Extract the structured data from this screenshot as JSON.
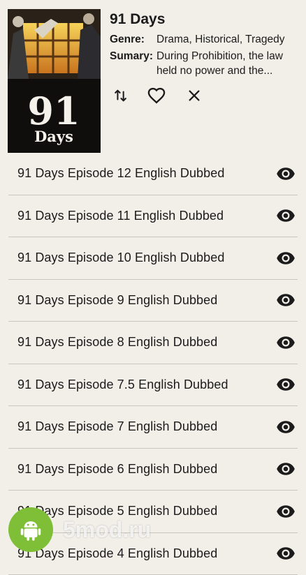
{
  "anime": {
    "title": "91 Days",
    "genre_label": "Genre:",
    "genre_value": "Drama, Historical, Tragedy",
    "summary_label": "Sumary:",
    "summary_value": "During Prohibition, the law held no power and the...",
    "poster_text_big": "91",
    "poster_text_small": "Days"
  },
  "actions": {
    "sort_icon": "swap-vertical-icon",
    "favorite_icon": "heart-outline-icon",
    "close_icon": "close-icon"
  },
  "episodes": [
    "91 Days Episode 12 English Dubbed",
    "91 Days Episode 11 English Dubbed",
    "91 Days Episode 10 English Dubbed",
    "91 Days Episode 9 English Dubbed",
    "91 Days Episode 8 English Dubbed",
    "91 Days Episode 7.5 English Dubbed",
    "91 Days Episode 7 English Dubbed",
    "91 Days Episode 6 English Dubbed",
    "91 Days Episode 5 English Dubbed",
    "91 Days Episode 4 English Dubbed"
  ],
  "watermark": {
    "text": "5mod.ru",
    "icon": "android-icon"
  },
  "colors": {
    "background": "#f2efe9",
    "divider": "#c9c5bf",
    "text": "#1b1b1b",
    "watermark_green": "#7fbf38"
  }
}
